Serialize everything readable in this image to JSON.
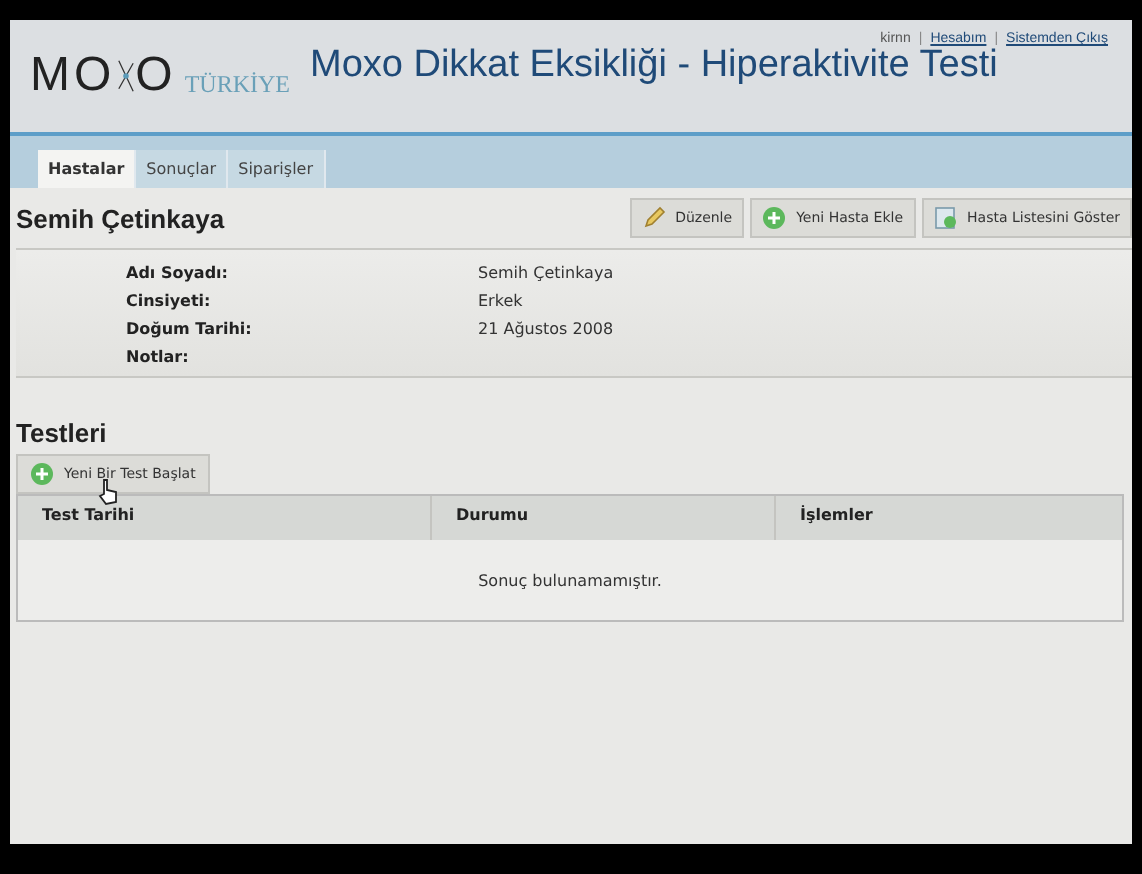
{
  "header": {
    "logo_text": [
      "MO",
      "O"
    ],
    "logo_sub": "TÜRKİYE",
    "title": "Moxo Dikkat Eksikliği - Hiperaktivite Testi",
    "user": "kirnn",
    "separator": "|",
    "links": [
      "Hesabım",
      "Sistemden Çıkış"
    ]
  },
  "tabs": [
    {
      "label": "Hastalar",
      "selected": true
    },
    {
      "label": "Sonuçlar",
      "selected": false
    },
    {
      "label": "Siparişler",
      "selected": false
    }
  ],
  "patient": {
    "name": "Semih Çetinkaya",
    "actions": [
      {
        "label": "Düzenle",
        "kind": "edit"
      },
      {
        "label": "Yeni Hasta Ekle",
        "kind": "add"
      },
      {
        "label": "Hasta Listesini Göster",
        "kind": "list"
      }
    ],
    "fields": [
      {
        "label": "Adı Soyadı:",
        "value": "Semih Çetinkaya"
      },
      {
        "label": "Cinsiyeti:",
        "value": "Erkek"
      },
      {
        "label": "Doğum Tarihi:",
        "value": "21 Ağustos 2008"
      },
      {
        "label": "Notlar:"
      }
    ]
  },
  "tests": {
    "heading": "Testleri",
    "new_button": "Yeni Bir Test Başlat",
    "columns": [
      "Test Tarihi",
      "Durumu",
      "İşlemler"
    ],
    "empty_message": "Sonuç bulunamamıştır."
  }
}
